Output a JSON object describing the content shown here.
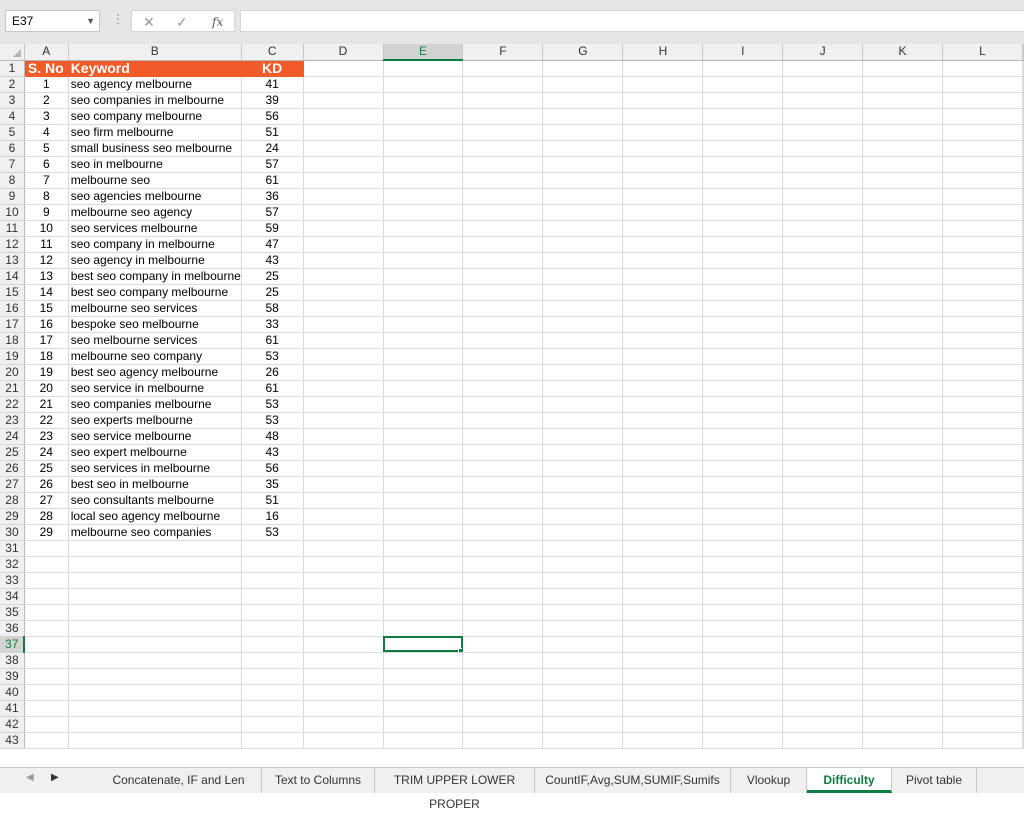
{
  "formula_bar": {
    "name_box": "E37",
    "name_box_arrow": "▼",
    "dots": "⋮",
    "cancel_icon": "✕",
    "enter_icon": "✓",
    "fx_label": "fx",
    "formula": ""
  },
  "columns": [
    "A",
    "B",
    "C",
    "D",
    "E",
    "F",
    "G",
    "H",
    "I",
    "J",
    "K",
    "L"
  ],
  "selected_column": "E",
  "selected_row": 37,
  "header_row": {
    "a": "S. No",
    "b": "Keyword",
    "c": "KD"
  },
  "rows": [
    {
      "a": "1",
      "b": "seo agency melbourne",
      "c": "41"
    },
    {
      "a": "2",
      "b": "seo companies in melbourne",
      "c": "39"
    },
    {
      "a": "3",
      "b": "seo company melbourne",
      "c": "56"
    },
    {
      "a": "4",
      "b": "seo firm melbourne",
      "c": "51"
    },
    {
      "a": "5",
      "b": "small business seo melbourne",
      "c": "24"
    },
    {
      "a": "6",
      "b": "seo in melbourne",
      "c": "57"
    },
    {
      "a": "7",
      "b": "melbourne seo",
      "c": "61"
    },
    {
      "a": "8",
      "b": "seo agencies melbourne",
      "c": "36"
    },
    {
      "a": "9",
      "b": "melbourne seo agency",
      "c": "57"
    },
    {
      "a": "10",
      "b": "seo services melbourne",
      "c": "59"
    },
    {
      "a": "11",
      "b": "seo company in melbourne",
      "c": "47"
    },
    {
      "a": "12",
      "b": "seo agency in melbourne",
      "c": "43"
    },
    {
      "a": "13",
      "b": "best seo company in melbourne",
      "c": "25"
    },
    {
      "a": "14",
      "b": "best seo company melbourne",
      "c": "25"
    },
    {
      "a": "15",
      "b": "melbourne seo services",
      "c": "58"
    },
    {
      "a": "16",
      "b": "bespoke seo melbourne",
      "c": "33"
    },
    {
      "a": "17",
      "b": "seo melbourne services",
      "c": "61"
    },
    {
      "a": "18",
      "b": "melbourne seo company",
      "c": "53"
    },
    {
      "a": "19",
      "b": "best seo agency melbourne",
      "c": "26"
    },
    {
      "a": "20",
      "b": "seo service in melbourne",
      "c": "61"
    },
    {
      "a": "21",
      "b": "seo companies melbourne",
      "c": "53"
    },
    {
      "a": "22",
      "b": "seo experts melbourne",
      "c": "53"
    },
    {
      "a": "23",
      "b": "seo service melbourne",
      "c": "48"
    },
    {
      "a": "24",
      "b": "seo expert melbourne",
      "c": "43"
    },
    {
      "a": "25",
      "b": "seo services in melbourne",
      "c": "56"
    },
    {
      "a": "26",
      "b": "best seo in melbourne",
      "c": "35"
    },
    {
      "a": "27",
      "b": "seo consultants melbourne",
      "c": "51"
    },
    {
      "a": "28",
      "b": "local seo agency melbourne",
      "c": "16"
    },
    {
      "a": "29",
      "b": "melbourne seo companies",
      "c": "53"
    }
  ],
  "sheet_tabs": {
    "nav_prev": "◀",
    "nav_next": "▶",
    "tabs": [
      "Concatenate, IF and Len",
      "Text to Columns",
      "TRIM UPPER LOWER PROPER",
      "CountIF,Avg,SUM,SUMIF,Sumifs",
      "Vlookup",
      "Difficulty",
      "Pivot table"
    ],
    "active": "Difficulty"
  },
  "colors": {
    "header_fill": "#f15a29",
    "accent": "#107c41"
  }
}
